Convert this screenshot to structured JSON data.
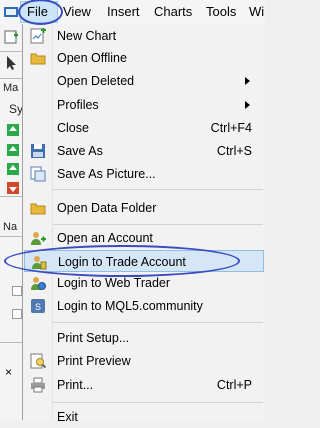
{
  "menubar": {
    "items": [
      "File",
      "View",
      "Insert",
      "Charts",
      "Tools",
      "Wi"
    ]
  },
  "background": {
    "panel_top_label": "Ma",
    "panel_sub_label": "Sy",
    "panel_nav_label": "Na"
  },
  "file_menu": {
    "items": [
      {
        "label": "New Chart",
        "icon": "new-chart-icon"
      },
      {
        "label": "Open Offline",
        "icon": "folder-icon"
      },
      {
        "label": "Open Deleted",
        "submenu": true
      },
      {
        "label": "Profiles",
        "submenu": true
      },
      {
        "label": "Close",
        "shortcut": "Ctrl+F4"
      },
      {
        "label": "Save As",
        "shortcut": "Ctrl+S",
        "icon": "floppy-disk-icon"
      },
      {
        "label": "Save As Picture...",
        "icon": "picture-icon"
      },
      {
        "label": "Open Data Folder",
        "icon": "folder-icon"
      },
      {
        "label": "Open an Account",
        "icon": "add-user-icon"
      },
      {
        "label": "Login to Trade Account",
        "icon": "login-user-icon",
        "selected": true
      },
      {
        "label": "Login to Web Trader",
        "icon": "web-trader-icon"
      },
      {
        "label": "Login to MQL5.community",
        "icon": "mql5-icon"
      },
      {
        "label": "Print Setup..."
      },
      {
        "label": "Print Preview",
        "icon": "print-preview-icon"
      },
      {
        "label": "Print...",
        "shortcut": "Ctrl+P",
        "icon": "printer-icon"
      },
      {
        "label": "Exit"
      }
    ]
  },
  "colors": {
    "highlight_ring": "#3a4cc0",
    "selected_background": "#d5e6f7",
    "selected_border": "#90bfe6"
  }
}
